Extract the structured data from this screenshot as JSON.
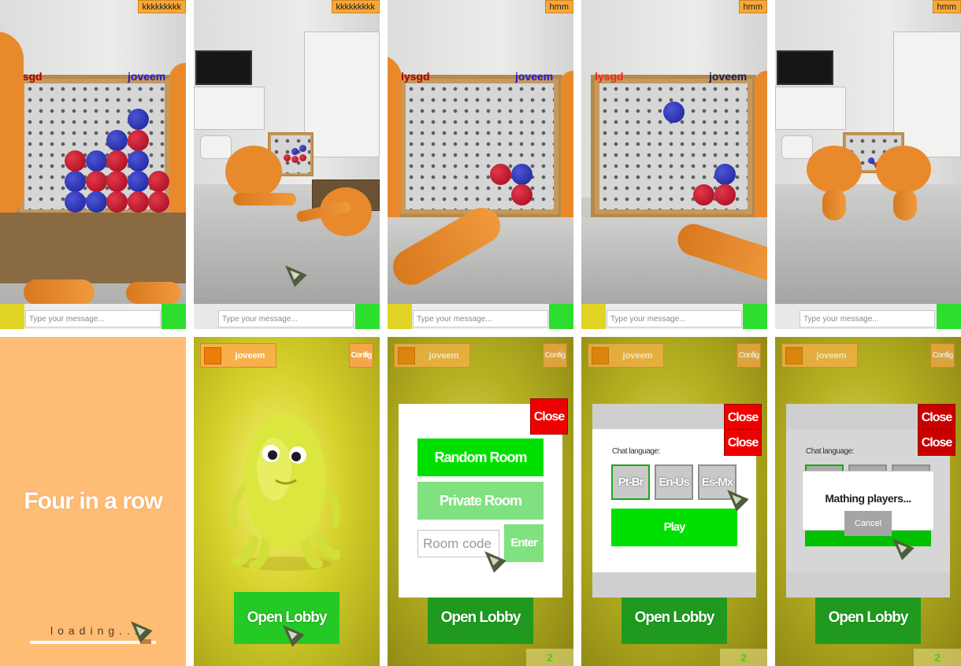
{
  "frames_top": [
    {
      "badge": "kkkkkkkkk",
      "player_left": "lysgd",
      "player_right": "joveem",
      "chat_placeholder": "Type your message..."
    },
    {
      "badge": "kkkkkkkkk",
      "chat_placeholder": "Type your message..."
    },
    {
      "badge": "hmm",
      "player_left": "lysgd",
      "player_right": "joveem",
      "chat_placeholder": "Type your message..."
    },
    {
      "badge": "hmm",
      "player_left": "lysgd",
      "player_right": "joveem",
      "chat_placeholder": "Type your message..."
    },
    {
      "badge": "hmm",
      "chat_placeholder": "Type your message..."
    }
  ],
  "loading_screen": {
    "title": "Four in a row",
    "loading_text": "loading...",
    "progress": 0.92
  },
  "menu": {
    "username": "joveem",
    "config_label": "Config",
    "open_lobby_label": "Open Lobby",
    "online_count": "2"
  },
  "room_dialog": {
    "close_label": "Close",
    "random_room_label": "Random Room",
    "private_room_label": "Private Room",
    "room_code_placeholder": "Room code",
    "enter_label": "Enter"
  },
  "language_dialog": {
    "close_label": "Close",
    "chat_language_label": "Chat language:",
    "languages": [
      "Pt-Br",
      "En-Us",
      "Es-Mx"
    ],
    "play_label": "Play"
  },
  "matching_dialog": {
    "text": "Mathing players...",
    "cancel_label": "Cancel"
  }
}
